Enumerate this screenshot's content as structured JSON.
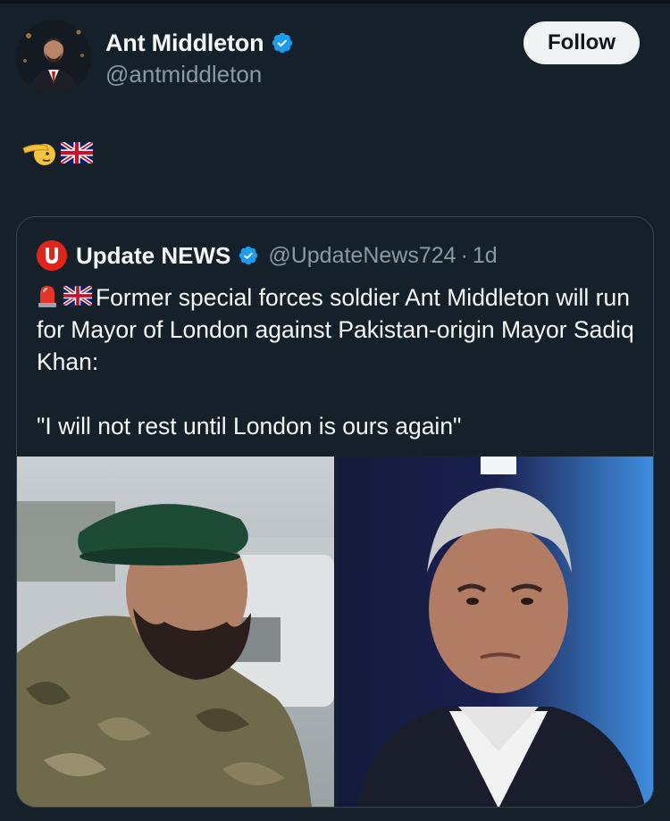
{
  "author": {
    "name": "Ant Middleton",
    "handle": "@antmiddleton",
    "verified": true,
    "avatar_icon": "profile-photo"
  },
  "follow_button": {
    "label": "Follow"
  },
  "tweet": {
    "emojis": [
      "saluting-face",
      "uk-flag"
    ]
  },
  "quote": {
    "name": "Update NEWS",
    "handle": "@UpdateNews724",
    "separator": "·",
    "time": "1d",
    "verified": true,
    "logo_letter": "U",
    "lead_emojis": [
      "police-light",
      "uk-flag"
    ],
    "text_line1": "Former special forces soldier Ant Middleton will run for Mayor of London against Pakistan-origin Mayor Sadiq Khan:",
    "text_line2": "\"I will not rest until London is ours again\"",
    "media": [
      {
        "icon": "photo-soldier-beret"
      },
      {
        "icon": "photo-man-suit"
      }
    ]
  },
  "colors": {
    "background": "#15202b",
    "text": "#f7f9f9",
    "secondary": "#8b98a5",
    "verified": "#1d9bf0",
    "border": "#38444d",
    "logo_red": "#e0241a"
  }
}
